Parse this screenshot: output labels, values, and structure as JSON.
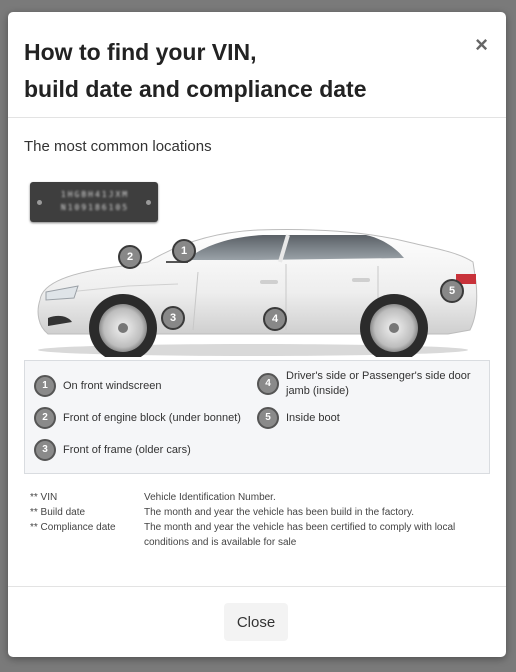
{
  "modal": {
    "title_line1": "How to find your VIN,",
    "title_line2": "build date and compliance date",
    "close_symbol": "×",
    "subtitle": "The most common locations"
  },
  "plate": {
    "line1": "1HGBH41JXM",
    "line2": "N109186105"
  },
  "markers": [
    "1",
    "2",
    "3",
    "4",
    "5"
  ],
  "legend": [
    {
      "num": "1",
      "label": "On front windscreen"
    },
    {
      "num": "2",
      "label": "Front of engine block (under bonnet)"
    },
    {
      "num": "3",
      "label": "Front of frame (older cars)"
    },
    {
      "num": "4",
      "label": "Driver's side or Passenger's side door jamb (inside)"
    },
    {
      "num": "5",
      "label": "Inside boot"
    }
  ],
  "definitions": [
    {
      "term": "** VIN",
      "desc": "Vehicle Identification Number."
    },
    {
      "term": "** Build date",
      "desc": "The month and year the vehicle has been build in the factory."
    },
    {
      "term": "** Compliance date",
      "desc": "The month and year the vehicle has been certified to comply with local conditions and is available for sale"
    }
  ],
  "footer": {
    "close_label": "Close"
  },
  "colors": {
    "overlay": "#7a7a7a",
    "legend_bg": "#f5f6f8",
    "marker": "#888888",
    "taillight": "#c8323a"
  }
}
